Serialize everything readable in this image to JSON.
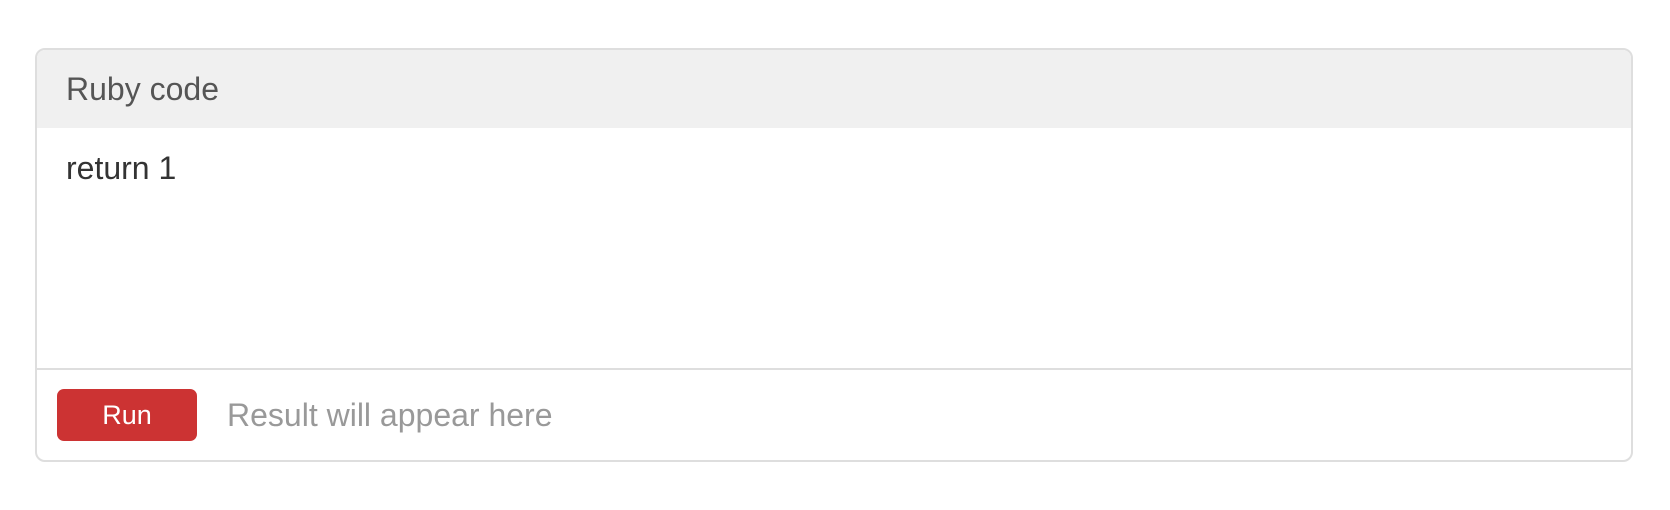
{
  "panel": {
    "title": "Ruby code",
    "code": "return 1"
  },
  "footer": {
    "run_label": "Run",
    "result_placeholder": "Result will appear here"
  },
  "colors": {
    "accent": "#cc3333",
    "header_bg": "#f0f0f0",
    "border": "#dedede",
    "muted_text": "#999999"
  }
}
